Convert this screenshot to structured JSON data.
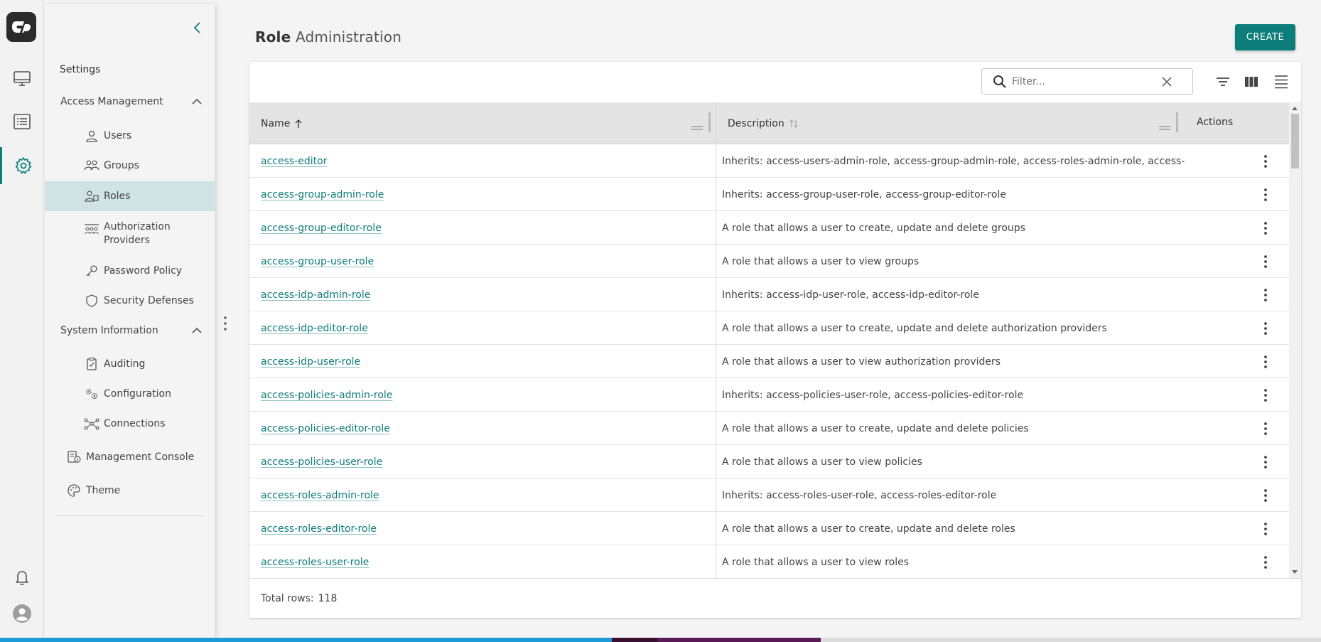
{
  "colors": {
    "accent": "#0d7d7a",
    "active_bg": "#cfe3e4"
  },
  "rail": {
    "items": [
      {
        "name": "dashboard",
        "icon": "monitor-icon"
      },
      {
        "name": "list",
        "icon": "list-icon"
      },
      {
        "name": "settings",
        "icon": "gear-icon"
      },
      {
        "name": "notifications",
        "icon": "bell-icon"
      },
      {
        "name": "profile",
        "icon": "avatar-icon"
      }
    ]
  },
  "sidebar": {
    "title": "Settings",
    "access_management": {
      "label": "Access Management",
      "items": [
        {
          "label": "Users",
          "icon": "user-icon"
        },
        {
          "label": "Groups",
          "icon": "groups-icon"
        },
        {
          "label": "Roles",
          "icon": "roles-icon",
          "active": true
        },
        {
          "label": "Authorization Providers",
          "icon": "auth-providers-icon"
        },
        {
          "label": "Password Policy",
          "icon": "key-icon"
        },
        {
          "label": "Security Defenses",
          "icon": "shield-icon"
        }
      ]
    },
    "system_information": {
      "label": "System Information",
      "items": [
        {
          "label": "Auditing",
          "icon": "clipboard-icon"
        },
        {
          "label": "Configuration",
          "icon": "cogs-icon"
        },
        {
          "label": "Connections",
          "icon": "connections-icon"
        }
      ]
    },
    "management_console": "Management Console",
    "theme": "Theme"
  },
  "page": {
    "title_bold": "Role",
    "title_rest": "Administration",
    "create_label": "CREATE"
  },
  "table": {
    "filter_placeholder": "Filter...",
    "columns": {
      "name": "Name",
      "description": "Description",
      "actions": "Actions"
    },
    "rows": [
      {
        "name": "access-editor",
        "description": "Inherits: access-users-admin-role, access-group-admin-role, access-roles-admin-role, access-idp"
      },
      {
        "name": "access-group-admin-role",
        "description": "Inherits: access-group-user-role, access-group-editor-role"
      },
      {
        "name": "access-group-editor-role",
        "description": "A role that allows a user to create, update and delete groups"
      },
      {
        "name": "access-group-user-role",
        "description": "A role that allows a user to view groups"
      },
      {
        "name": "access-idp-admin-role",
        "description": "Inherits: access-idp-user-role, access-idp-editor-role"
      },
      {
        "name": "access-idp-editor-role",
        "description": "A role that allows a user to create, update and delete authorization providers"
      },
      {
        "name": "access-idp-user-role",
        "description": "A role that allows a user to view authorization providers"
      },
      {
        "name": "access-policies-admin-role",
        "description": "Inherits: access-policies-user-role, access-policies-editor-role"
      },
      {
        "name": "access-policies-editor-role",
        "description": "A role that allows a user to create, update and delete policies"
      },
      {
        "name": "access-policies-user-role",
        "description": "A role that allows a user to view policies"
      },
      {
        "name": "access-roles-admin-role",
        "description": "Inherits: access-roles-user-role, access-roles-editor-role"
      },
      {
        "name": "access-roles-editor-role",
        "description": "A role that allows a user to create, update and delete roles"
      },
      {
        "name": "access-roles-user-role",
        "description": "A role that allows a user to view roles"
      }
    ],
    "total_label": "Total rows:",
    "total_value": "118"
  }
}
